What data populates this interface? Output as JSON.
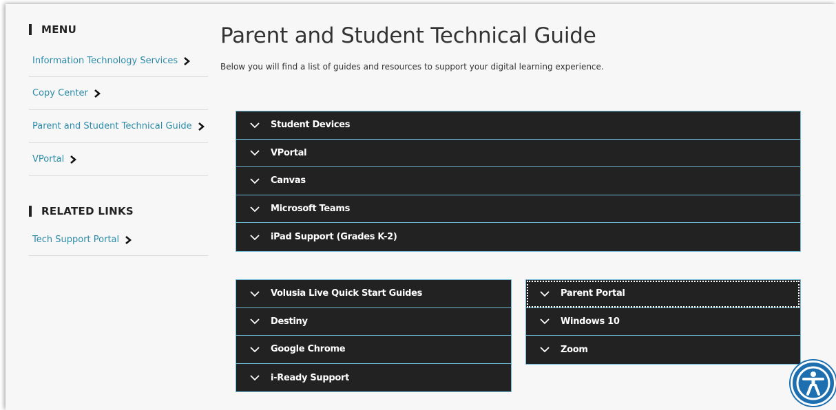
{
  "sidebar": {
    "menu_heading": "MENU",
    "menu_items": [
      {
        "label": "Information Technology Services"
      },
      {
        "label": "Copy Center"
      },
      {
        "label": "Parent and Student Technical Guide"
      },
      {
        "label": "VPortal"
      }
    ],
    "related_heading": "RELATED LINKS",
    "related_items": [
      {
        "label": "Tech Support Portal"
      }
    ]
  },
  "main": {
    "title": "Parent and Student Technical Guide",
    "subtitle": "Below you will find a list of guides and resources to support your digital learning experience."
  },
  "accordion_top": [
    {
      "label": "Student Devices"
    },
    {
      "label": "VPortal"
    },
    {
      "label": "Canvas"
    },
    {
      "label": "Microsoft Teams"
    },
    {
      "label": "iPad Support (Grades K-2)"
    }
  ],
  "accordion_left": [
    {
      "label": "Volusia Live Quick Start Guides"
    },
    {
      "label": "Destiny"
    },
    {
      "label": "Google Chrome"
    },
    {
      "label": "i-Ready Support"
    }
  ],
  "accordion_right": [
    {
      "label": "Parent Portal"
    },
    {
      "label": "Windows 10"
    },
    {
      "label": "Zoom"
    }
  ],
  "icons": {
    "chevron": "chevron-right-icon",
    "expand": "chevron-down-icon",
    "accessibility": "accessibility-icon"
  },
  "colors": {
    "link": "#2c8ba8",
    "accordion_bg": "#222222",
    "accordion_border": "#6fb8d6",
    "accessibility_bg": "#1e6fb0"
  }
}
